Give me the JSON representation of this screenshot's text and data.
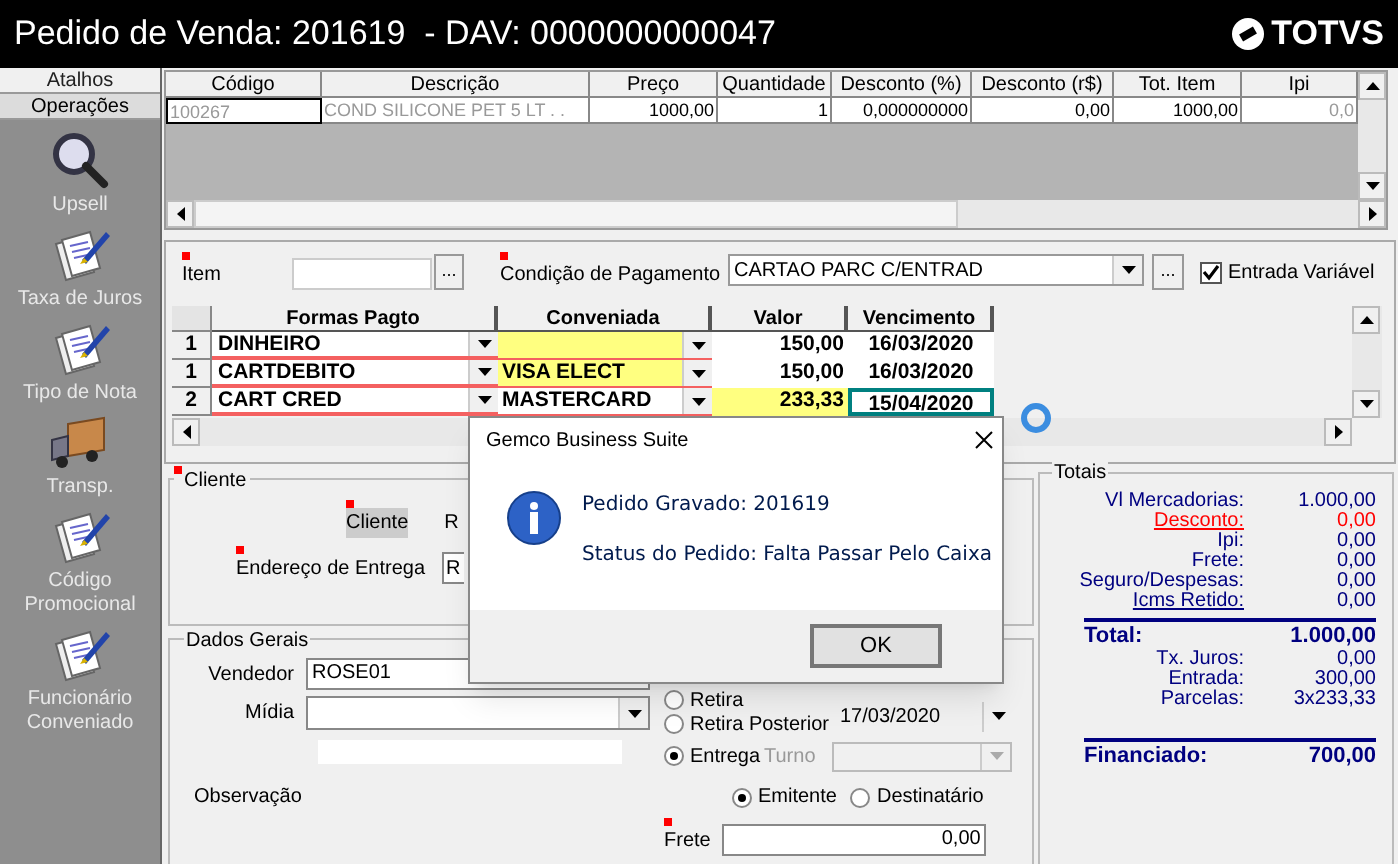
{
  "window": {
    "title": "Pedido de Venda: 201619  - DAV: 0000000000047",
    "brand": "TOTVS"
  },
  "sidebar": {
    "tabs": [
      {
        "label": "Atalhos",
        "selected": false
      },
      {
        "label": "Operações",
        "selected": true
      }
    ],
    "items": [
      {
        "label": "Upsell",
        "kind": "magnifier"
      },
      {
        "label": "Taxa de Juros",
        "kind": "document"
      },
      {
        "label": "Tipo de Nota",
        "kind": "document"
      },
      {
        "label": "Transp.",
        "kind": "truck"
      },
      {
        "label": "Código Promocional",
        "kind": "document"
      },
      {
        "label": "Funcionário Conveniado",
        "kind": "document"
      }
    ]
  },
  "items_table": {
    "columns": [
      "Código",
      "Descrição",
      "Preço",
      "Quantidade",
      "Desconto (%)",
      "Desconto (r$)",
      "Tot. Item",
      "Ipi"
    ],
    "rows": [
      [
        "100267",
        "COND SILICONE PET 5 LT  . .",
        "1000,00",
        "1",
        "0,000000000",
        "0,00",
        "1000,00",
        "0,0"
      ]
    ]
  },
  "item_field": {
    "label": "Item",
    "button": "..."
  },
  "payment_condition": {
    "label": "Condição de Pagamento",
    "value": "CARTAO PARC C/ENTRAD",
    "button": "..."
  },
  "entrada_variavel": {
    "label": "Entrada Variável",
    "checked": true
  },
  "payments": {
    "columns": [
      "Formas Pagto",
      "Conveniada",
      "Valor",
      "Vencimento"
    ],
    "rows": [
      {
        "count": "1",
        "forma": "DINHEIRO",
        "valor": "150,00",
        "vencimento": "16/03/2020",
        "selected": false
      },
      {
        "count": "1",
        "forma": "CARTDEBITO",
        "conveniada": "VISA ELECT",
        "valor": "150,00",
        "vencimento": "16/03/2020",
        "selected": false
      },
      {
        "count": "2",
        "forma": "CART CRED",
        "conveniada": "MASTERCARD",
        "valor": "233,33",
        "vencimento": "15/04/2020",
        "selected": true
      }
    ]
  },
  "cliente": {
    "title": "Cliente",
    "client_label": "Cliente",
    "client_value": "R",
    "address_label": "Endereço de Entrega",
    "address_value": "R"
  },
  "dados_gerais": {
    "title": "Dados Gerais",
    "vendedor_label": "Vendedor",
    "vendedor": "ROSE01",
    "midia_label": "Mídia",
    "observacao_label": "Observação",
    "delivery": [
      {
        "label": "Retira",
        "selected": false
      },
      {
        "label": "Retira Posterior",
        "selected": false
      },
      {
        "label": "Entrega",
        "selected": true
      }
    ],
    "date": "17/03/2020",
    "turno_label": "Turno",
    "frete_by": [
      {
        "label": "Emitente",
        "selected": true
      },
      {
        "label": "Destinatário",
        "selected": false
      }
    ],
    "frete_label": "Frete",
    "frete": "0,00"
  },
  "totais": {
    "title": "Totais",
    "lines": [
      {
        "label": "Vl Mercadorias:",
        "value": "1.000,00",
        "kind": "plain"
      },
      {
        "label": "Desconto:",
        "value": "0,00",
        "kind": "alert"
      },
      {
        "label": "Ipi:",
        "value": "0,00",
        "kind": "plain"
      },
      {
        "label": "Frete:",
        "value": "0,00",
        "kind": "plain"
      },
      {
        "label": "Seguro/Despesas:",
        "value": "0,00",
        "kind": "plain"
      },
      {
        "label": "Icms Retido:",
        "value": "0,00",
        "kind": "link"
      },
      {
        "label": "Total:",
        "value": "1.000,00",
        "kind": "total"
      },
      {
        "label": "Tx. Juros:",
        "value": "0,00",
        "kind": "plain"
      },
      {
        "label": "Entrada:",
        "value": "300,00",
        "kind": "plain"
      },
      {
        "label": "Parcelas:",
        "value": "3x233,33",
        "kind": "plain"
      },
      {
        "label": "Financiado:",
        "value": "700,00",
        "kind": "total"
      }
    ]
  },
  "dialog": {
    "title": "Gemco Business Suite",
    "lines": [
      "Pedido Gravado: 201619",
      "Status do Pedido: Falta Passar Pelo Caixa"
    ],
    "button": "OK"
  }
}
